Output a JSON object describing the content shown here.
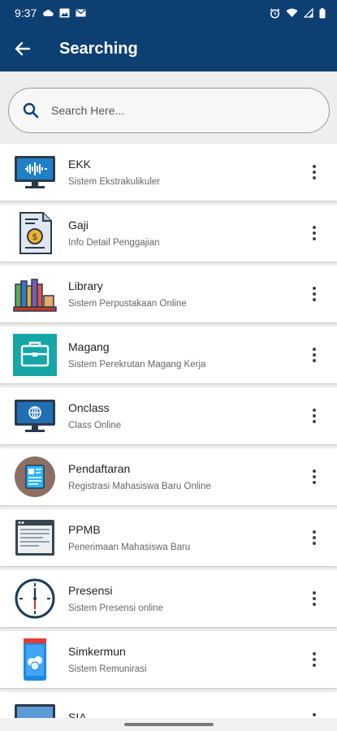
{
  "status_bar": {
    "time": "9:37",
    "left_icons": [
      "cloud-icon",
      "image-icon",
      "gmail-icon"
    ],
    "right_icons": [
      "alarm-icon",
      "wifi-icon",
      "signal-icon",
      "battery-icon"
    ]
  },
  "appbar": {
    "back_icon": "arrow-left-icon",
    "title": "Searching"
  },
  "search": {
    "placeholder": "Search Here...",
    "value": ""
  },
  "items": [
    {
      "title": "EKK",
      "subtitle": "Sistem Ekstrakulikuler",
      "icon": "monitor-audio-icon"
    },
    {
      "title": "Gaji",
      "subtitle": "Info Detail Penggajian",
      "icon": "payslip-icon"
    },
    {
      "title": "Library",
      "subtitle": "Sistem Perpustakaan Online",
      "icon": "books-icon"
    },
    {
      "title": "Magang",
      "subtitle": "Sistem Perekrutan Magang Kerja",
      "icon": "briefcase-icon"
    },
    {
      "title": "Onclass",
      "subtitle": "Class Online",
      "icon": "monitor-globe-icon"
    },
    {
      "title": "Pendaftaran",
      "subtitle": "Registrasi Mahasiswa Baru Online",
      "icon": "registration-form-icon"
    },
    {
      "title": "PPMB",
      "subtitle": "Penerimaan Mahasiswa Baru",
      "icon": "browser-window-icon"
    },
    {
      "title": "Presensi",
      "subtitle": "Sistem Presensi online",
      "icon": "clock-icon"
    },
    {
      "title": "Simkermun",
      "subtitle": "Sistem Remunirasi",
      "icon": "phone-money-icon"
    },
    {
      "title": "SIA",
      "subtitle": "",
      "icon": "monitor-icon"
    }
  ],
  "colors": {
    "primary": "#0e3f72",
    "background": "#eeeeee",
    "card": "#ffffff"
  }
}
